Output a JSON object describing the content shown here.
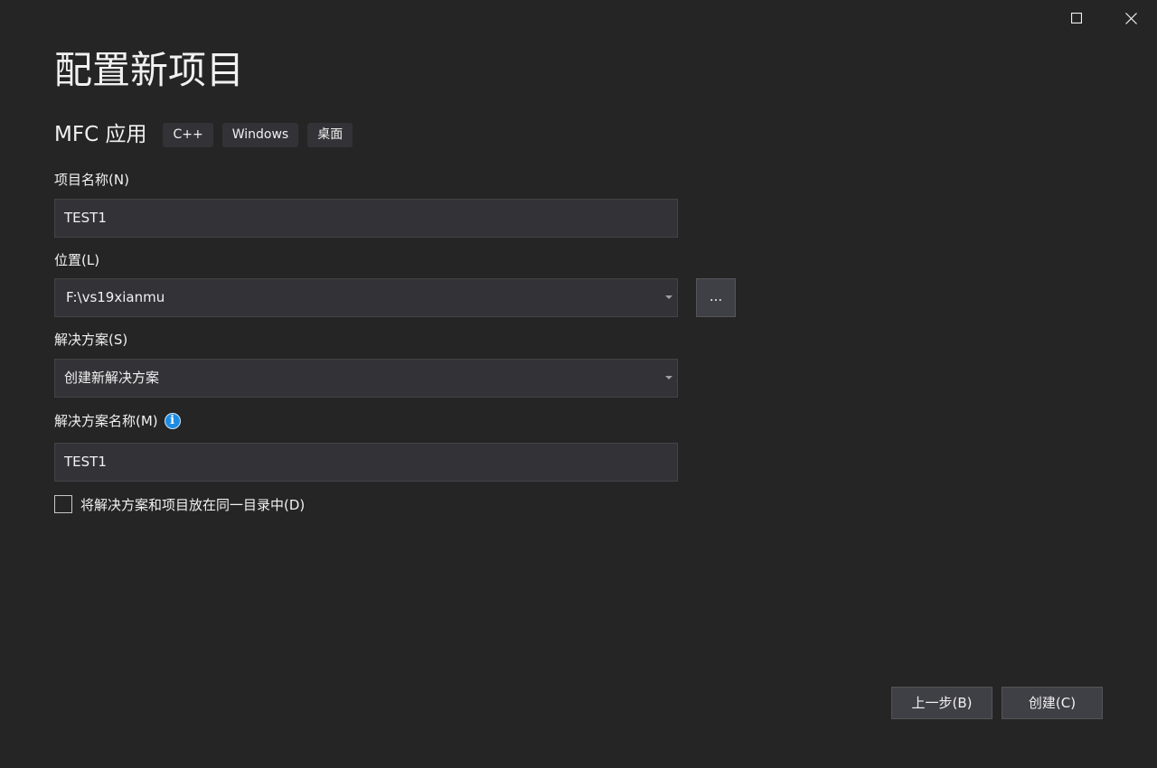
{
  "window": {
    "title": "配置新项目",
    "controls": {
      "maximize_icon": "maximize-icon",
      "close_icon": "close-icon"
    }
  },
  "template": {
    "name": "MFC 应用",
    "tags": [
      "C++",
      "Windows",
      "桌面"
    ]
  },
  "project_name": {
    "label": "项目名称(N)",
    "value": "TEST1"
  },
  "location": {
    "label": "位置(L)",
    "value": "F:\\vs19xianmu",
    "browse_label": "..."
  },
  "solution": {
    "label": "解决方案(S)",
    "value": "创建新解决方案"
  },
  "solution_name": {
    "label": "解决方案名称(M)",
    "info_icon": "info-icon",
    "info_glyph": "i",
    "value": "TEST1"
  },
  "same_directory": {
    "label": "将解决方案和项目放在同一目录中(D)",
    "checked": false
  },
  "footer": {
    "back_label": "上一步(B)",
    "create_label": "创建(C)"
  },
  "colors": {
    "background": "#252526",
    "input_background": "#333337",
    "button_background": "#3f3f46",
    "info_blue": "#1e8ce3",
    "text": "#f1f1f1"
  }
}
